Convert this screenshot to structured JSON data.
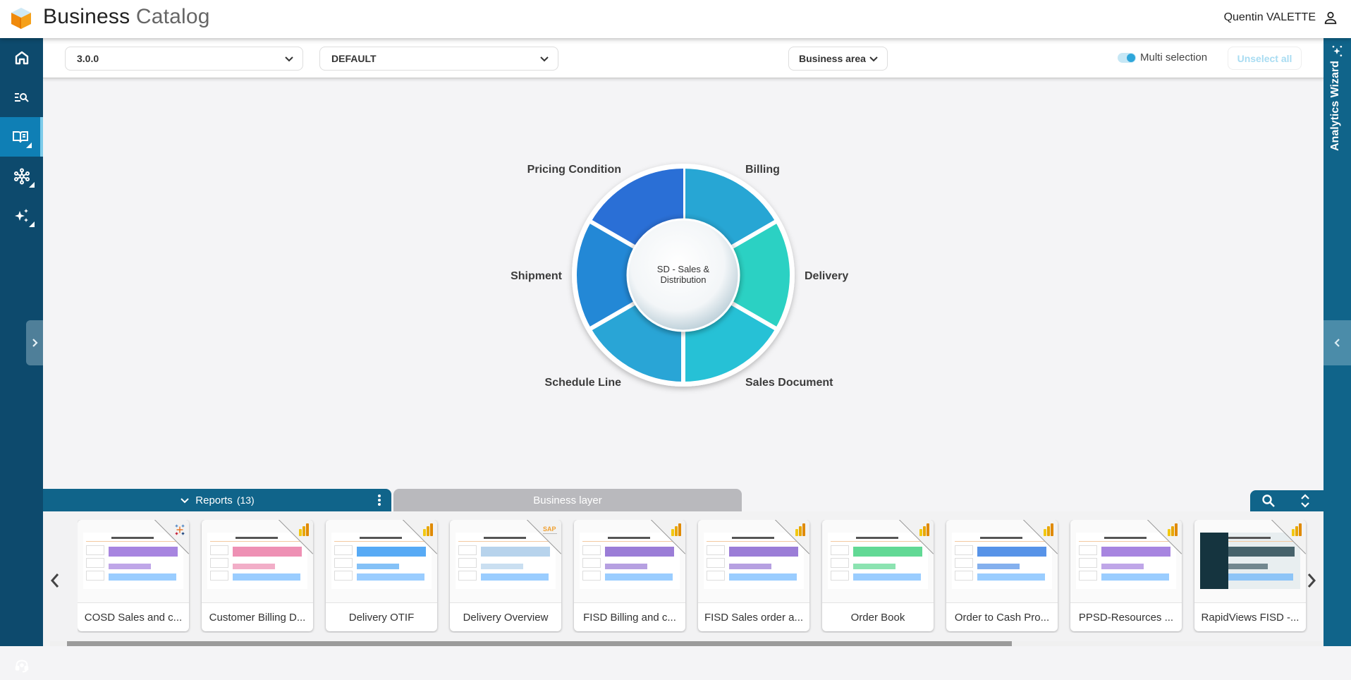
{
  "app": {
    "title_bold": "Business",
    "title_thin": "Catalog",
    "user_name": "Quentin VALETTE"
  },
  "left_nav": {
    "items": [
      {
        "name": "home",
        "icon": "home-icon",
        "active": false
      },
      {
        "name": "search",
        "icon": "search-list-icon",
        "active": false
      },
      {
        "name": "catalog",
        "icon": "book-icon",
        "active": true
      },
      {
        "name": "network",
        "icon": "network-icon",
        "active": false
      },
      {
        "name": "sparkles",
        "icon": "sparkles-icon",
        "active": false
      }
    ],
    "support_icon": "support-headset-icon"
  },
  "toolbar": {
    "version_select": "3.0.0",
    "profile_select": "DEFAULT",
    "view_select": "Business area",
    "multi_selection_label": "Multi selection",
    "multi_selection_on": true,
    "unselect_all_label": "Unselect all"
  },
  "right_panel": {
    "label": "Analytics Wizard"
  },
  "wheel": {
    "center_label_line1": "SD - Sales &",
    "center_label_line2": "Distribution",
    "segments": [
      {
        "label": "Billing",
        "color": "#27a6d4"
      },
      {
        "label": "Delivery",
        "color": "#2bd1c3"
      },
      {
        "label": "Sales Document",
        "color": "#26c1d6"
      },
      {
        "label": "Schedule Line",
        "color": "#29a5d6"
      },
      {
        "label": "Shipment",
        "color": "#2388d6"
      },
      {
        "label": "Pricing Condition",
        "color": "#2a6fd6"
      }
    ]
  },
  "bottom_panel": {
    "reports_tab_label": "Reports",
    "reports_count": "(13)",
    "business_layer_tab_label": "Business layer",
    "cards": [
      {
        "title": "COSD Sales and c...",
        "tool": "tableau"
      },
      {
        "title": "Customer Billing D...",
        "tool": "powerbi"
      },
      {
        "title": "Delivery OTIF",
        "tool": "powerbi"
      },
      {
        "title": "Delivery Overview",
        "tool": "sap"
      },
      {
        "title": "FISD Billing and c...",
        "tool": "powerbi"
      },
      {
        "title": "FISD Sales order a...",
        "tool": "powerbi"
      },
      {
        "title": "Order Book",
        "tool": "powerbi"
      },
      {
        "title": "Order to Cash Pro...",
        "tool": "powerbi"
      },
      {
        "title": "PPSD-Resources ...",
        "tool": "powerbi"
      },
      {
        "title": "RapidViews FISD -...",
        "tool": "powerbi"
      }
    ]
  }
}
